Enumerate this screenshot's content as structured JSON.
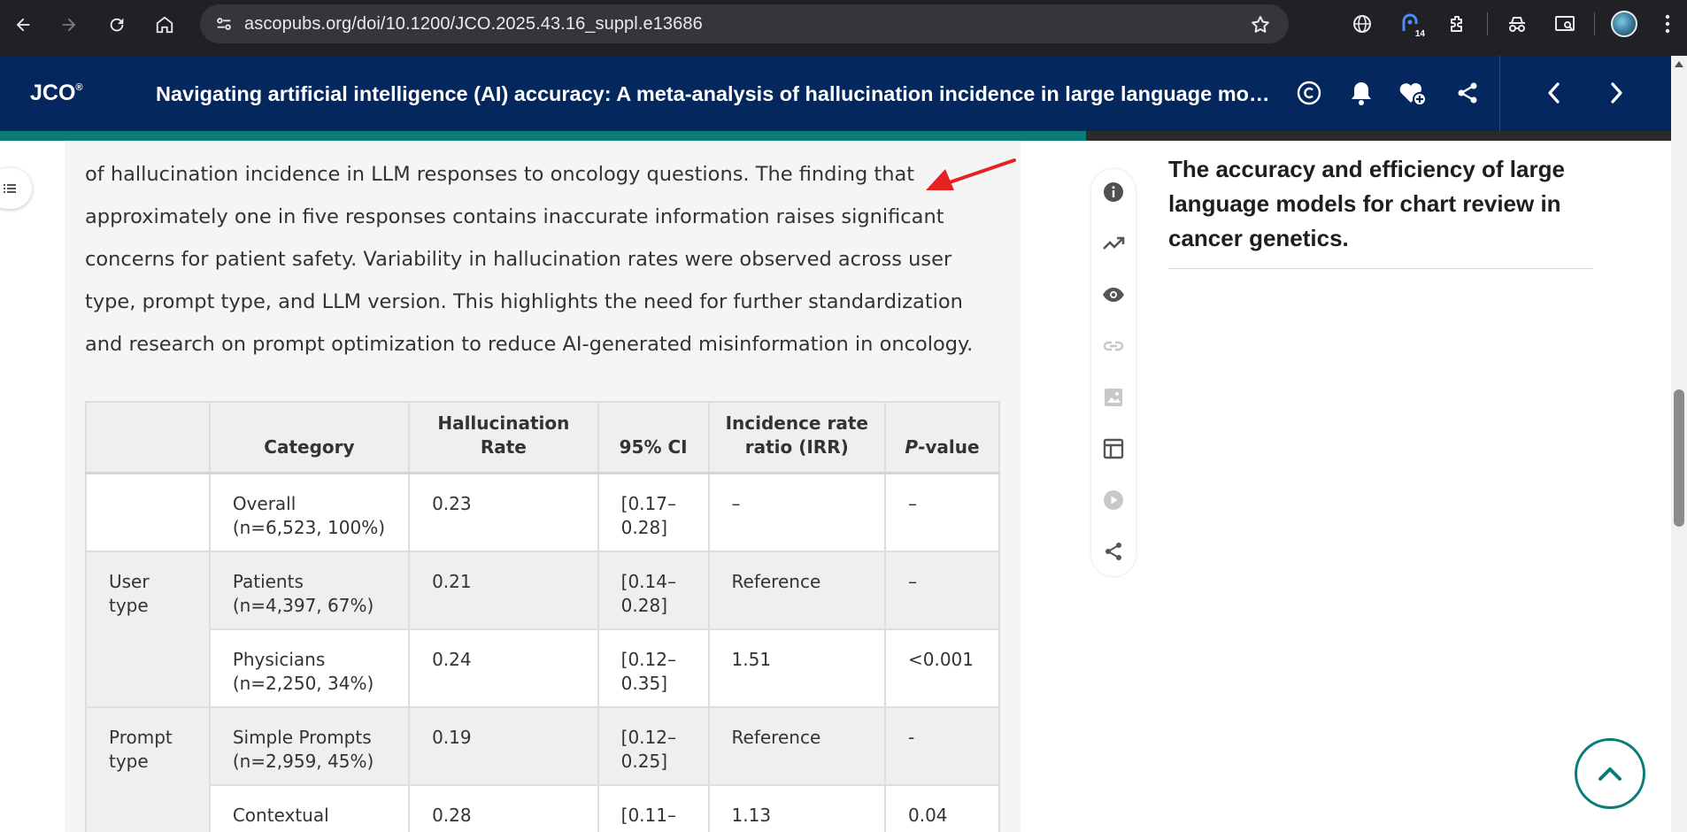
{
  "browser": {
    "url": "ascopubs.org/doi/10.1200/JCO.2025.43.16_suppl.e13686",
    "extension_badge": "14"
  },
  "journal": {
    "logo": "JCO",
    "logo_mark": "®",
    "title": "Navigating artificial intelligence (AI) accuracy: A meta-analysis of hallucination incidence in large language models in oncology",
    "reading_progress": 0.65
  },
  "article": {
    "paragraph": "of hallucination incidence in LLM responses to oncology questions. The finding that approximately one in five responses contains inaccurate information raises significant concerns for patient safety. Variability in hallucination rates were observed across user type, prompt type, and LLM version. This highlights the need for further standardization and research on prompt optimization to reduce AI-generated misinformation in oncology.",
    "table": {
      "headers": {
        "group": "",
        "category": "Category",
        "rate": "Hallucination Rate",
        "ci": "95% CI",
        "irr": "Incidence rate ratio (IRR)",
        "p_italic": "P",
        "p_rest": "-value"
      },
      "rows": [
        {
          "group": "",
          "category": "Overall (n=6,523, 100%)",
          "rate": "0.23",
          "ci": "[0.17–0.28]",
          "irr": "–",
          "p": "–"
        },
        {
          "group": "User type",
          "category": "Patients (n=4,397, 67%)",
          "rate": "0.21",
          "ci": "[0.14–0.28]",
          "irr": "Reference",
          "p": "–"
        },
        {
          "group": "",
          "category": "Physicians (n=2,250, 34%)",
          "rate": "0.24",
          "ci": "[0.12–0.35]",
          "irr": "1.51",
          "p": "<0.001"
        },
        {
          "group": "Prompt type",
          "category": "Simple Prompts (n=2,959, 45%)",
          "rate": "0.19",
          "ci": "[0.12–0.25]",
          "irr": "Reference",
          "p": "-"
        },
        {
          "group": "",
          "category": "Contextual",
          "rate": "0.28",
          "ci": "[0.11–",
          "irr": "1.13",
          "p": "0.04"
        }
      ]
    }
  },
  "related": {
    "title": "The accuracy and efficiency of large language models for chart review in cancer genetics."
  },
  "colors": {
    "header_bg": "#04285e",
    "accent_teal": "#0a7c78",
    "annotation_arrow": "#e52222"
  }
}
